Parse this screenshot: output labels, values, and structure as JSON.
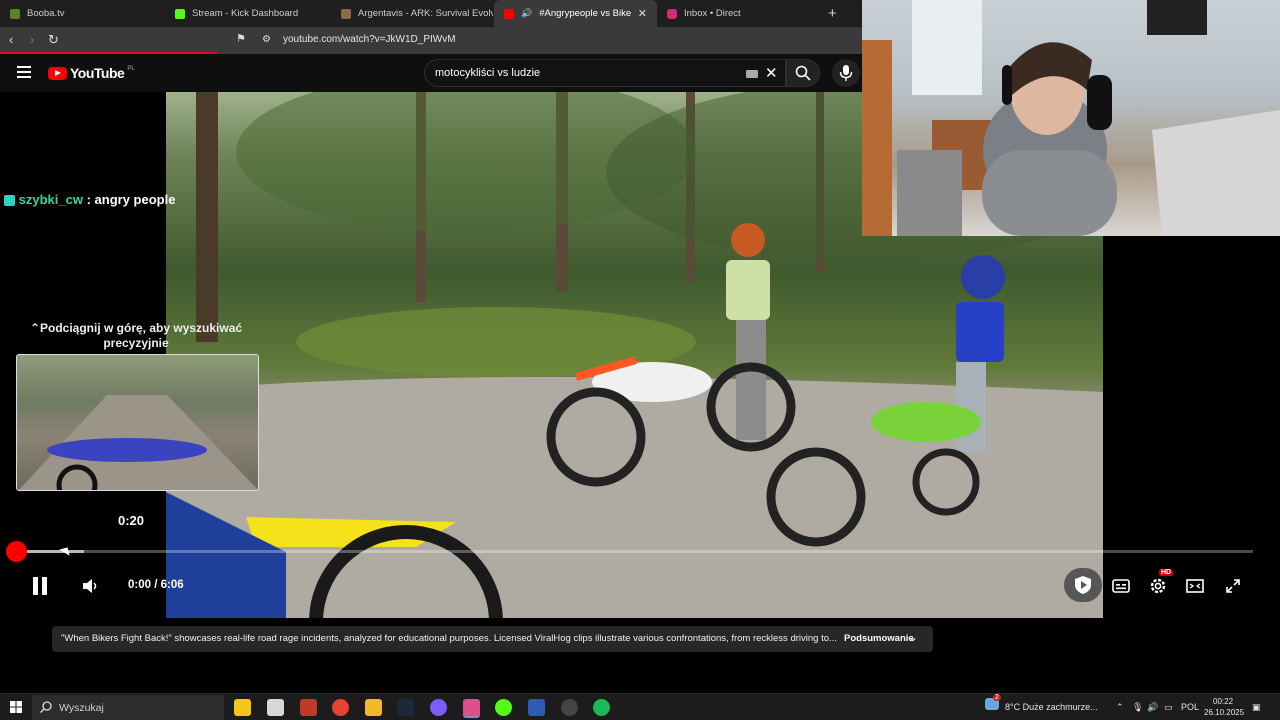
{
  "tabs": [
    {
      "title": "Booba.tv",
      "color": "#5b7f2e",
      "active": false
    },
    {
      "title": "Stream - Kick Dashboard",
      "color": "#53fc18",
      "active": false
    },
    {
      "title": "Argentavis - ARK: Survival Evolved W",
      "color": "#8a6a4a",
      "active": false
    },
    {
      "title": "#Angrypeople vs Bikers - You",
      "color": "#ff0000",
      "active": true
    },
    {
      "title": "Inbox • Direct",
      "color": "#d62976",
      "active": false
    }
  ],
  "addressbar": {
    "url": "youtube.com/watch?v=JkW1D_PIWvM"
  },
  "youtube": {
    "logo_text": "YouTube",
    "region": "PL",
    "search_value": "motocykliści vs ludzie"
  },
  "overlay": {
    "chat_user": "szybki_cw",
    "chat_sep": ":",
    "chat_message": "angry people",
    "hint": "Podciągnij w górę, aby wyszukiwać precyzyjnie",
    "preview_time": "0:20"
  },
  "player": {
    "time": "0:00 / 6:06",
    "quality_badge": "HD",
    "played_fraction": 0.0,
    "buffered_fraction": 0.055
  },
  "description": {
    "text": "\"When Bikers Fight Back!\" showcases real-life road rage incidents, analyzed for educational purposes. Licensed ViralHog clips illustrate various confrontations, from reckless driving to...",
    "summary_button": "Podsumowanie"
  },
  "taskbar": {
    "search_placeholder": "Wyszukaj",
    "weather_badge": "2",
    "weather": "8°C  Duże zachmurze...",
    "lang": "POL",
    "time": "00:22",
    "date": "26.10.2025"
  },
  "icons": {
    "menu": "hamburger-icon",
    "search": "search-icon",
    "mic": "mic-icon",
    "pause": "pause-icon",
    "volume": "volume-icon",
    "captions": "captions-icon",
    "settings": "gear-icon",
    "theater": "theater-icon",
    "fullscreen": "fullscreen-icon"
  }
}
